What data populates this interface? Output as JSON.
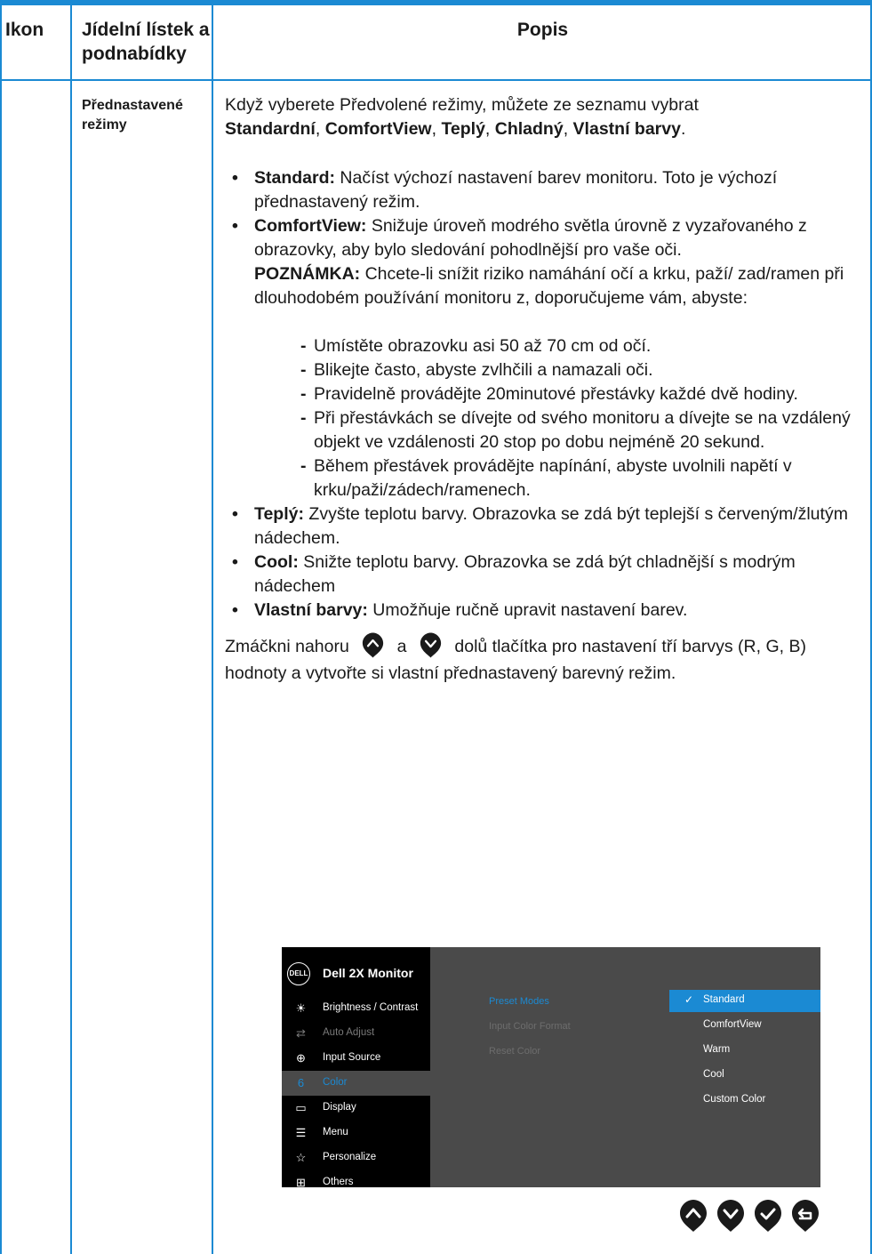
{
  "headers": {
    "icon": "Ikon",
    "menu": "Jídelní lístek a podnabídky",
    "description": "Popis"
  },
  "submenu": {
    "label": "Přednastavené režimy"
  },
  "description": {
    "intro_prefix": "Když vyberete Předvolené režimy, můžete ze seznamu vybrat",
    "modes": [
      "Standardní",
      "ComfortView",
      "Teplý",
      "Chladný",
      "Vlastní barvy"
    ],
    "intro_sep": ", ",
    "intro_end": ".",
    "bullets": [
      {
        "term": "Standard:",
        "text": " Načíst výchozí nastavení barev monitoru. Toto je výchozí přednastavený režim."
      },
      {
        "term": "ComfortView:",
        "text": " Snižuje úroveň modrého světla úrovně z vyzařovaného z obrazovky, aby bylo sledování pohodlnější pro vaše oči."
      },
      {
        "term": "Teplý:",
        "text": " Zvyšte teplotu barvy. Obrazovka se zdá být teplejší s červeným/žlutým nádechem."
      },
      {
        "term": "Cool:",
        "text": " Snižte teplotu barvy. Obrazovka se zdá být chladnější s modrým nádechem"
      },
      {
        "term": "Vlastní barvy:",
        "text": " Umožňuje ručně upravit nastavení barev."
      }
    ],
    "note_term": "POZNÁMKA:",
    "note_text": " Chcete-li snížit riziko namáhání očí a krku, paží/ zad/ramen při dlouhodobém používání monitoru z, doporučujeme vám, abyste:",
    "tips": [
      "Umístěte obrazovku asi 50 až 70 cm od očí.",
      "Blikejte často, abyste zvlhčili a namazali oči.",
      "Pravidelně provádějte 20minutové přestávky každé dvě hodiny.",
      "Při přestávkách se dívejte od svého monitoru a dívejte se na vzdálený objekt ve vzdálenosti 20 stop po dobu nejméně 20 sekund.",
      "Během přestávek provádějte napínání, abyste uvolnili napětí v krku/paži/zádech/ramenech."
    ],
    "custom_a": "Zmáčkni nahoru",
    "custom_b": "a",
    "custom_c": "dolů tlačítka pro nastavení tří barvys (R, G, B) hodnoty a vytvořte si vlastní přednastavený barevný režim."
  },
  "osd": {
    "logo": "DELL",
    "title": "Dell 2X Monitor",
    "menu_items": [
      {
        "label": "Brightness / Contrast",
        "icon": "brightness-icon",
        "state": "normal"
      },
      {
        "label": "Auto Adjust",
        "icon": "auto-adjust-icon",
        "state": "dim"
      },
      {
        "label": "Input Source",
        "icon": "input-source-icon",
        "state": "normal"
      },
      {
        "label": "Color",
        "icon": "color-icon",
        "state": "active"
      },
      {
        "label": "Display",
        "icon": "display-icon",
        "state": "normal"
      },
      {
        "label": "Menu",
        "icon": "menu-icon",
        "state": "normal"
      },
      {
        "label": "Personalize",
        "icon": "star-icon",
        "state": "normal"
      },
      {
        "label": "Others",
        "icon": "others-icon",
        "state": "normal"
      }
    ],
    "submenu": [
      {
        "label": "Preset Modes",
        "state": "active"
      },
      {
        "label": "Input Color Format",
        "state": "dim"
      },
      {
        "label": "Reset Color",
        "state": "dim"
      }
    ],
    "options": [
      {
        "label": "Standard",
        "selected": true
      },
      {
        "label": "ComfortView",
        "selected": false
      },
      {
        "label": "Warm",
        "selected": false
      },
      {
        "label": "Cool",
        "selected": false
      },
      {
        "label": "Custom Color",
        "selected": false
      }
    ],
    "buttons": [
      "up-arrow-icon",
      "down-arrow-icon",
      "check-icon",
      "back-icon"
    ]
  },
  "colors": {
    "accent": "#1b8ad3",
    "osd_left": "#000000",
    "osd_right": "#4a4a4a",
    "button_fill": "#1a1a1a"
  }
}
